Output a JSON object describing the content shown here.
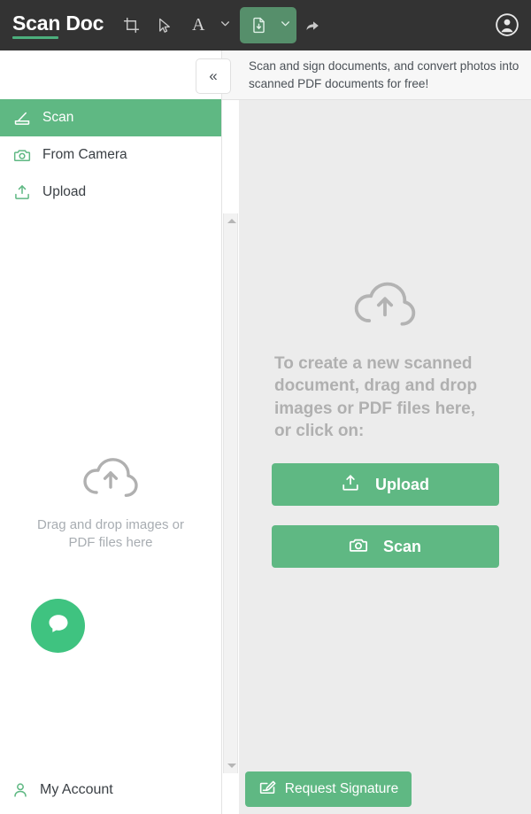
{
  "header": {
    "logo_scan": "Scan",
    "logo_doc": "Doc",
    "tools": [
      {
        "name": "crop-icon",
        "label": "Crop"
      },
      {
        "name": "pointer-icon",
        "label": "Select"
      },
      {
        "name": "text-icon",
        "label": "A"
      },
      {
        "name": "document-download-icon",
        "label": "Download document"
      },
      {
        "name": "share-icon",
        "label": "Share"
      }
    ],
    "avatar_label": "Account",
    "bar_color": "#333333",
    "active_tool_color": "#568f6b"
  },
  "topstrip": {
    "collapse_label": "«",
    "tagline": "Scan and sign documents, and convert photos into scanned PDF documents for free!"
  },
  "sidebar": {
    "items": [
      {
        "label": "Scan",
        "icon": "scanner-icon",
        "active": true
      },
      {
        "label": "From Camera",
        "icon": "camera-icon",
        "active": false
      },
      {
        "label": "Upload",
        "icon": "upload-icon",
        "active": false
      }
    ],
    "dropzone": {
      "icon": "cloud-upload-icon",
      "text": "Drag and drop images or PDF files here"
    },
    "chat_fab": "chat-bubble-icon",
    "account_label": "My Account",
    "account_icon": "person-icon",
    "accent_color": "#5fb883"
  },
  "main": {
    "dropzone_icon": "cloud-upload-icon",
    "instruction": "To create a new scanned document, drag and drop images or PDF files here, or click on:",
    "buttons": [
      {
        "label": "Upload",
        "icon": "upload-icon"
      },
      {
        "label": "Scan",
        "icon": "camera-icon"
      }
    ],
    "background_color": "#ececec",
    "button_color": "#5fb883"
  },
  "footer": {
    "request_signature_label": "Request Signature",
    "request_signature_icon": "signature-pen-icon"
  },
  "scrollbar": {
    "up_arrow": "chevron-up-icon",
    "down_arrow": "chevron-down-icon"
  }
}
